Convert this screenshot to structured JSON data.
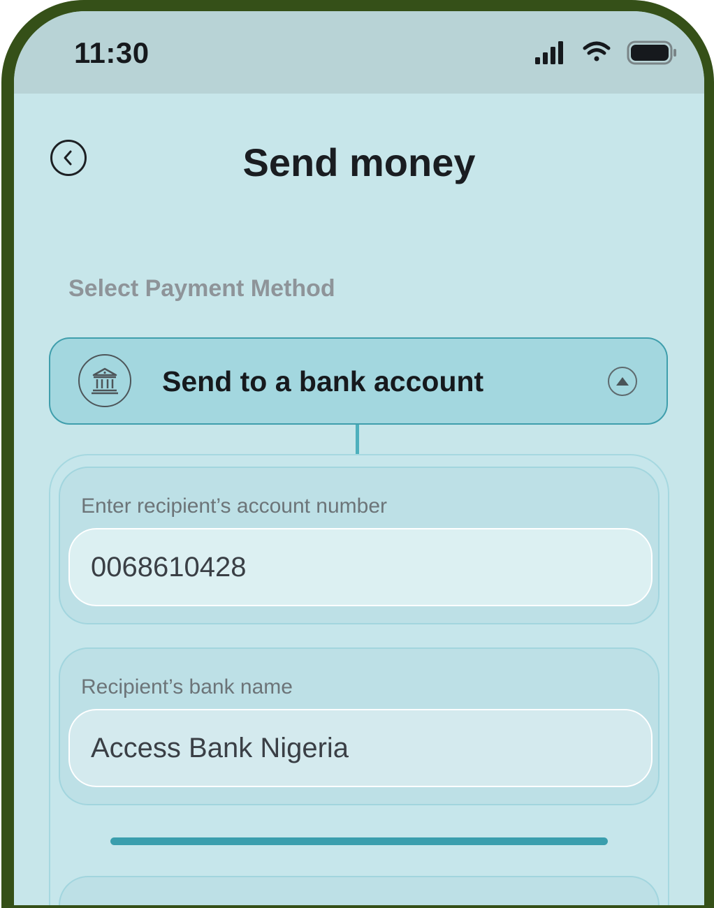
{
  "status_bar": {
    "time": "11:30",
    "icons": [
      "signal-icon",
      "wifi-icon",
      "battery-icon"
    ]
  },
  "header": {
    "title": "Send money",
    "back_icon": "chevron-left-icon"
  },
  "payment": {
    "section_label": "Select Payment Method",
    "method": {
      "label": "Send to a bank account",
      "icon": "bank-icon",
      "toggle_icon": "chevron-up-icon"
    },
    "fields": [
      {
        "label": "Enter recipient’s account number",
        "value": "0068610428"
      },
      {
        "label": "Recipient’s bank name",
        "value": "Access Bank Nigeria"
      }
    ],
    "progress": 1.0
  },
  "colors": {
    "accent": "#3a9ead",
    "background": "#c7e6ea",
    "frame": "#355018"
  }
}
